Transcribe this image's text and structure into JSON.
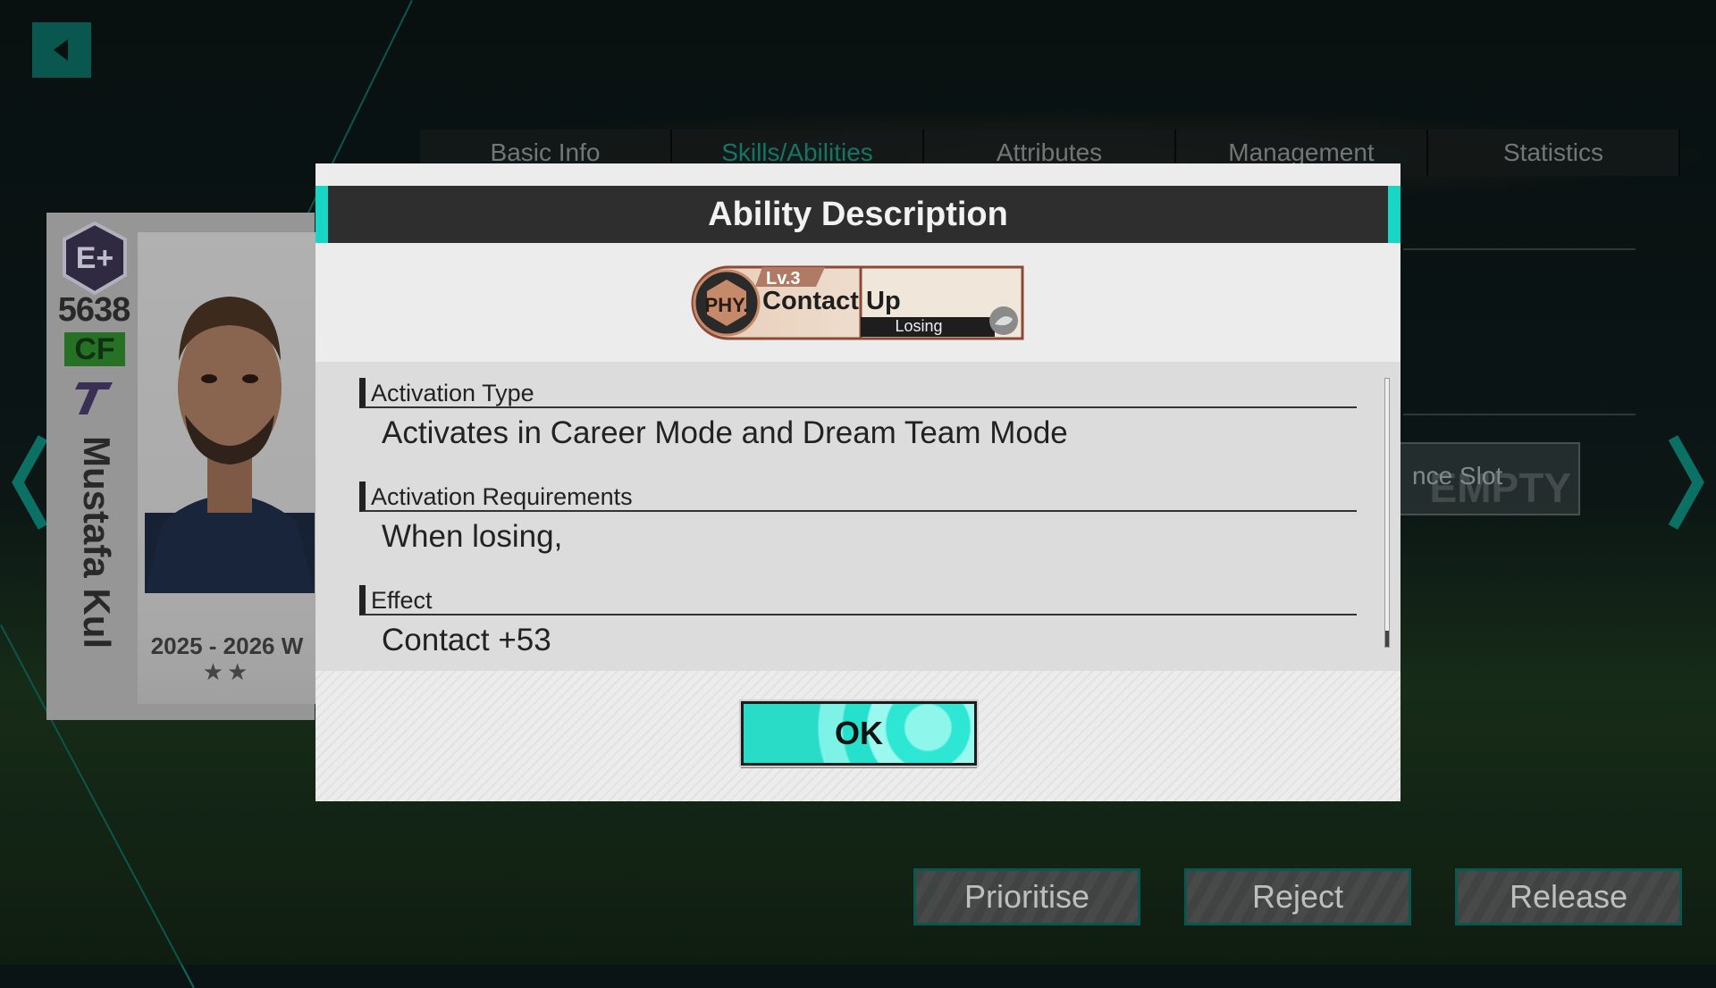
{
  "tabs": [
    {
      "label": "Basic Info",
      "active": false
    },
    {
      "label": "Skills/Abilities",
      "active": true
    },
    {
      "label": "Attributes",
      "active": false
    },
    {
      "label": "Management",
      "active": false
    },
    {
      "label": "Statistics",
      "active": false
    }
  ],
  "player": {
    "rank_icon": "e-plus-rank-badge",
    "rating": "5638",
    "position": "CF",
    "name": "Mustafa Kul",
    "season": "2025 - 2026 W",
    "stars": "★★"
  },
  "slot": {
    "label": "nce Slot",
    "watermark": "EMPTY"
  },
  "bottom_buttons": {
    "prioritise": "Prioritise",
    "reject": "Reject",
    "release": "Release"
  },
  "dialog": {
    "title": "Ability Description",
    "ability": {
      "category": "PHY.",
      "level": "Lv.3",
      "name": "Contact Up",
      "condition": "Losing",
      "condition_icon": "losing-icon"
    },
    "sections": [
      {
        "heading": "Activation Type",
        "body": "Activates in Career Mode and Dream Team Mode"
      },
      {
        "heading": "Activation Requirements",
        "body": "When losing,"
      },
      {
        "heading": "Effect",
        "body": "Contact +53"
      }
    ],
    "ok_label": "OK"
  },
  "colors": {
    "accent": "#18d6c6",
    "teal_dark": "#0d6b62",
    "active_tab": "#1a8f7c"
  }
}
